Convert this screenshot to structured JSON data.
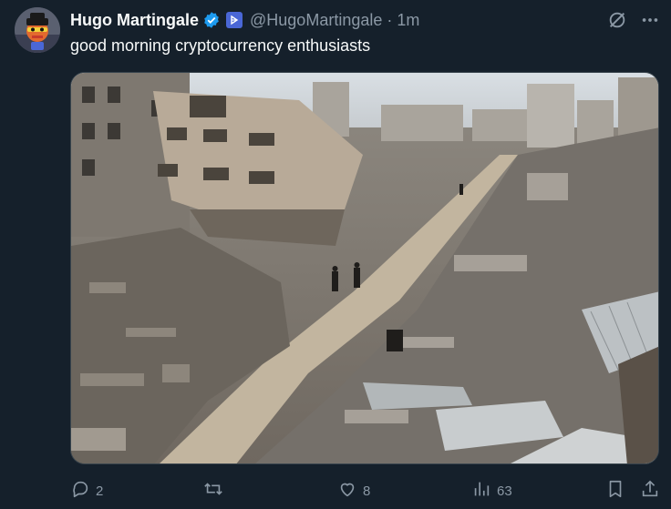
{
  "tweet": {
    "author": {
      "display_name": "Hugo Martingale",
      "handle": "@HugoMartingale",
      "verified_icon": "verified-badge-icon",
      "affiliate_icon": "affiliate-badge-icon"
    },
    "separator": "·",
    "timestamp": "1m",
    "text": "good morning cryptocurrency enthusiasts",
    "media": {
      "type": "photo",
      "subject": "street through destroyed buildings and rubble"
    },
    "header_icons": [
      "grok-icon",
      "more-icon"
    ],
    "metrics": {
      "replies": "2",
      "retweets": "",
      "likes": "8",
      "views": "63"
    },
    "action_icons": [
      "reply-icon",
      "retweet-icon",
      "like-icon",
      "views-icon",
      "bookmark-icon",
      "share-icon"
    ]
  },
  "colors": {
    "background": "#15202b",
    "text_primary": "#f7f9f9",
    "text_secondary": "#8b98a5",
    "verified_blue": "#1d9bf0",
    "border": "#38444d"
  }
}
